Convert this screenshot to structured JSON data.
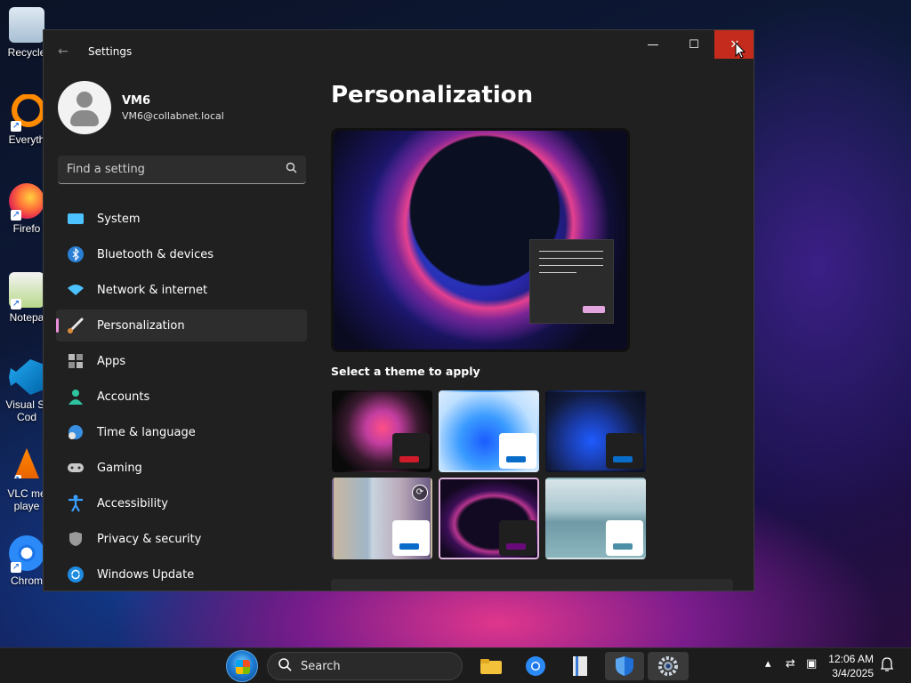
{
  "desktop": {
    "icons": [
      {
        "label": "Recycle"
      },
      {
        "label": "Everyth"
      },
      {
        "label": "Firefo"
      },
      {
        "label": "Notepa"
      },
      {
        "label": "Visual St\nCod"
      },
      {
        "label": "VLC me\nplaye"
      },
      {
        "label": "Chrom"
      }
    ]
  },
  "window": {
    "title": "Settings",
    "controls": {
      "minimize": "—",
      "maximize": "☐",
      "close": "✕"
    }
  },
  "profile": {
    "name": "VM6",
    "email": "VM6@collabnet.local"
  },
  "search": {
    "placeholder": "Find a setting"
  },
  "nav": {
    "items": [
      {
        "label": "System",
        "icon": "system-icon"
      },
      {
        "label": "Bluetooth & devices",
        "icon": "bluetooth-icon"
      },
      {
        "label": "Network & internet",
        "icon": "wifi-icon"
      },
      {
        "label": "Personalization",
        "icon": "paintbrush-icon",
        "active": true
      },
      {
        "label": "Apps",
        "icon": "apps-icon"
      },
      {
        "label": "Accounts",
        "icon": "accounts-icon"
      },
      {
        "label": "Time & language",
        "icon": "clock-globe-icon"
      },
      {
        "label": "Gaming",
        "icon": "gamepad-icon"
      },
      {
        "label": "Accessibility",
        "icon": "accessibility-icon"
      },
      {
        "label": "Privacy & security",
        "icon": "shield-icon"
      },
      {
        "label": "Windows Update",
        "icon": "update-icon"
      }
    ]
  },
  "main": {
    "title": "Personalization",
    "themes_heading": "Select a theme to apply",
    "themes": [
      {
        "chip_color": "#1f1f1f",
        "bar_color": "#d01c2a"
      },
      {
        "chip_color": "#ffffff",
        "bar_color": "#0a6cc9"
      },
      {
        "chip_color": "#1f1f1f",
        "bar_color": "#0a6cc9"
      },
      {
        "chip_color": "#ffffff",
        "bar_color": "#0a6cc9",
        "slideshow": true
      },
      {
        "chip_color": "#1f1f1f",
        "bar_color": "#6a0a7a",
        "selected": true
      },
      {
        "chip_color": "#ffffff",
        "bar_color": "#4a8fa6"
      }
    ]
  },
  "taskbar": {
    "search_label": "Search",
    "clock_time": "12:06 AM",
    "clock_date": "3/4/2025"
  },
  "colors": {
    "accent": "#e98ed8",
    "close_hover": "#c42b1c"
  }
}
